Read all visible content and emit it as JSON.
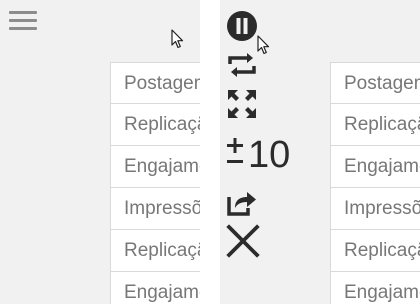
{
  "rows": [
    "Postagem",
    "Replicação",
    "Engajamento",
    "Impressões",
    "Replicação",
    "Engajamento"
  ],
  "controls": {
    "step_label": "10",
    "icons": [
      "pause-icon",
      "repeat-icon",
      "fullscreen-icon",
      "plus-minus-icon",
      "share-icon",
      "close-icon"
    ]
  },
  "colors": {
    "panel_bg": "#f1f1f1",
    "icon": "#2b2b2b",
    "menu": "#8c8c8c"
  }
}
